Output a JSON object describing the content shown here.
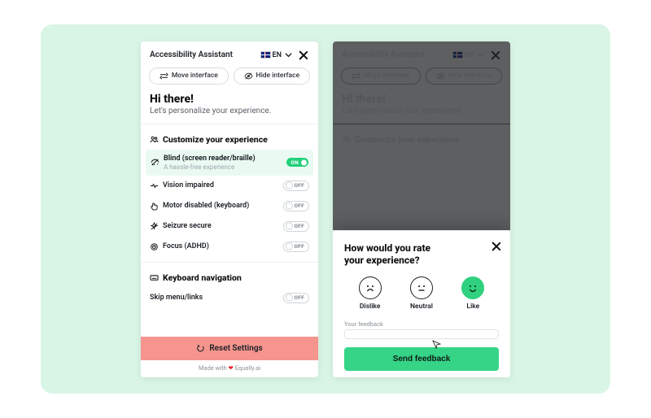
{
  "header": {
    "title": "Accessibility Assistant",
    "lang_code": "EN"
  },
  "chips": {
    "move": "Move interface",
    "hide": "Hide interface"
  },
  "greeting": {
    "title": "Hi there!",
    "subtitle": "Let's personalize your experience."
  },
  "sections": {
    "customize": "Customize your experience",
    "keyboard": "Keyboard navigation"
  },
  "options": {
    "blind": {
      "label": "Blind (screen reader/braille)",
      "sub": "A hassle-free experience",
      "on_text": "ON"
    },
    "vision": {
      "label": "Vision impaired",
      "off_text": "OFF"
    },
    "motor": {
      "label": "Motor disabled (keyboard)",
      "off_text": "OFF"
    },
    "seizure": {
      "label": "Seizure secure",
      "off_text": "OFF"
    },
    "focus": {
      "label": "Focus (ADHD)",
      "off_text": "OFF"
    },
    "skip": {
      "label": "Skip menu/links",
      "off_text": "OFF"
    }
  },
  "reset": {
    "label": "Reset Settings"
  },
  "credit": {
    "prefix": "Made with ",
    "suffix": " Equally.ai"
  },
  "feedback": {
    "title_l1": "How would you rate",
    "title_l2": "your experience?",
    "dislike": "Dislike",
    "neutral": "Neutral",
    "like": "Like",
    "field_label": "Your feedback",
    "send": "Send feedback"
  },
  "colors": {
    "accent": "#2fd07e",
    "reset_bg": "#f5958e",
    "mint_bg": "#d9f5e6"
  }
}
